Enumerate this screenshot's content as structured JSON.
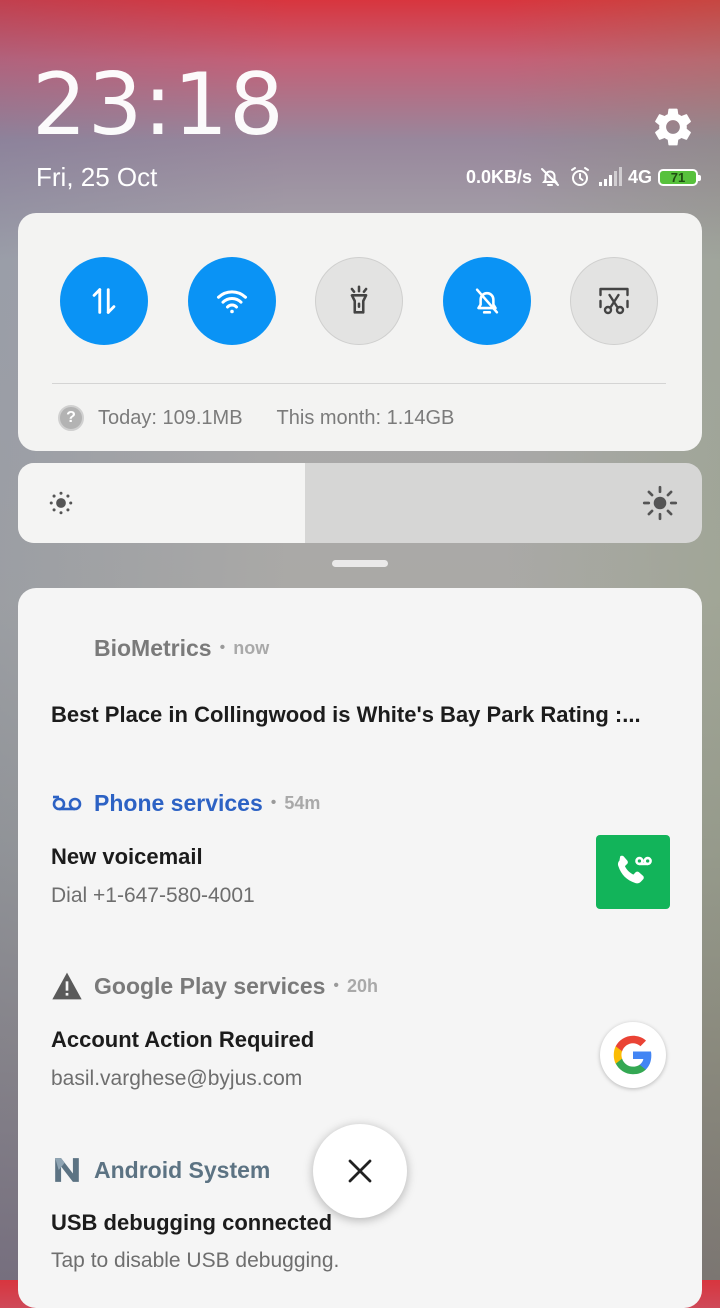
{
  "status": {
    "clock": "23:18",
    "date": "Fri, 25 Oct",
    "network_speed": "0.0KB/s",
    "network_type": "4G",
    "battery_level": "71"
  },
  "quick_settings": {
    "toggles": [
      {
        "name": "mobile-data-toggle",
        "icon": "data-arrows-icon",
        "state": "on"
      },
      {
        "name": "wifi-toggle",
        "icon": "wifi-icon",
        "state": "on"
      },
      {
        "name": "flashlight-toggle",
        "icon": "flashlight-icon",
        "state": "off"
      },
      {
        "name": "silent-toggle",
        "icon": "bell-off-icon",
        "state": "on"
      },
      {
        "name": "screenshot-toggle",
        "icon": "scissors-icon",
        "state": "off"
      }
    ],
    "data_today": "Today: 109.1MB",
    "data_month": "This month: 1.14GB"
  },
  "brightness": {
    "level": 0.42
  },
  "notifications": [
    {
      "app": "BioMetrics",
      "time": "now",
      "title": "Best Place in Collingwood is White's Bay Park Rating :...",
      "body": ""
    },
    {
      "app": "Phone services",
      "time": "54m",
      "title": "New voicemail",
      "body": "Dial +1-647-580-4001",
      "app_color": "#2d62c4"
    },
    {
      "app": "Google Play services",
      "time": "20h",
      "title": "Account Action Required",
      "body": "basil.varghese@byjus.com"
    },
    {
      "app": "Android System",
      "time": "",
      "title": "USB debugging connected",
      "body": "Tap to disable USB debugging.",
      "app_color": "#5c7383"
    }
  ],
  "colors": {
    "accent": "#0a93f5",
    "voicemail_green": "#12b45a"
  }
}
